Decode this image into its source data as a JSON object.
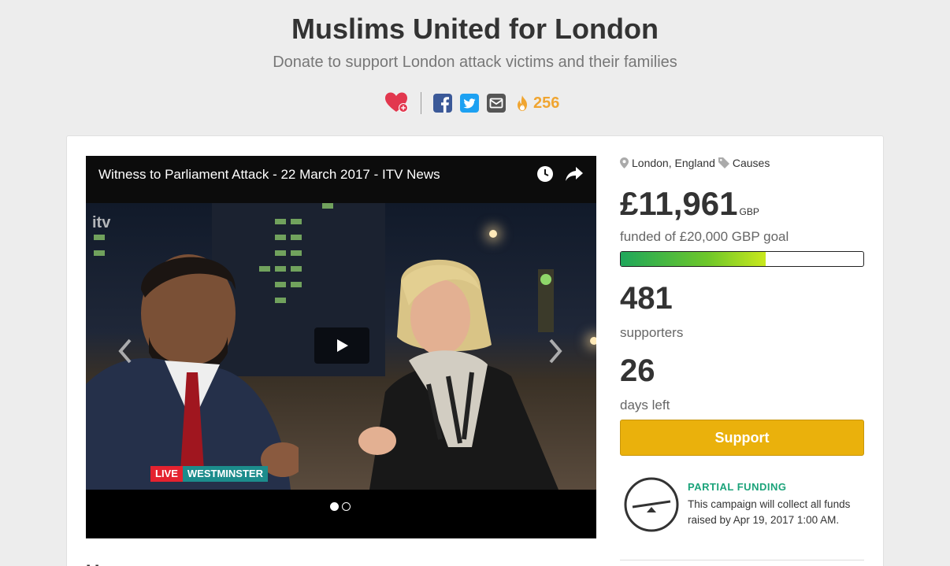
{
  "header": {
    "title": "Muslims United for London",
    "subtitle": "Donate to support London attack victims and their families",
    "trending_count": "256",
    "icons": [
      "heart-plus-icon",
      "facebook-icon",
      "twitter-icon",
      "email-icon",
      "flame-icon"
    ],
    "colors": {
      "heart": "#e2374e",
      "facebook": "#3b5998",
      "twitter": "#1da1f2",
      "email": "#555555",
      "trending": "#f0a531"
    }
  },
  "video": {
    "title": "Witness to Parliament Attack - 22 March 2017 - ITV News",
    "channel_logo": "itv",
    "live_label": "LIVE",
    "location_label": "WESTMINSTER",
    "slides_count": 2,
    "active_slide": 1,
    "icons": [
      "clock-icon",
      "share-arrow-icon",
      "play-icon",
      "chevron-left-icon",
      "chevron-right-icon"
    ]
  },
  "campaign": {
    "location": "London, England",
    "category": "Causes",
    "amount_raised": "£11,961",
    "currency": "GBP",
    "goal_text": "funded of £20,000 GBP goal",
    "progress_fraction": 0.598,
    "supporters_count": "481",
    "supporters_label": "supporters",
    "days_count": "26",
    "days_label": "days left",
    "support_button": "Support",
    "funding_type_title": "PARTIAL FUNDING",
    "funding_type_text": "This campaign will collect all funds raised by Apr 19, 2017 1:00 AM.",
    "colors": {
      "support_button": "#eab10c",
      "funding_title": "#1ba37a"
    }
  }
}
